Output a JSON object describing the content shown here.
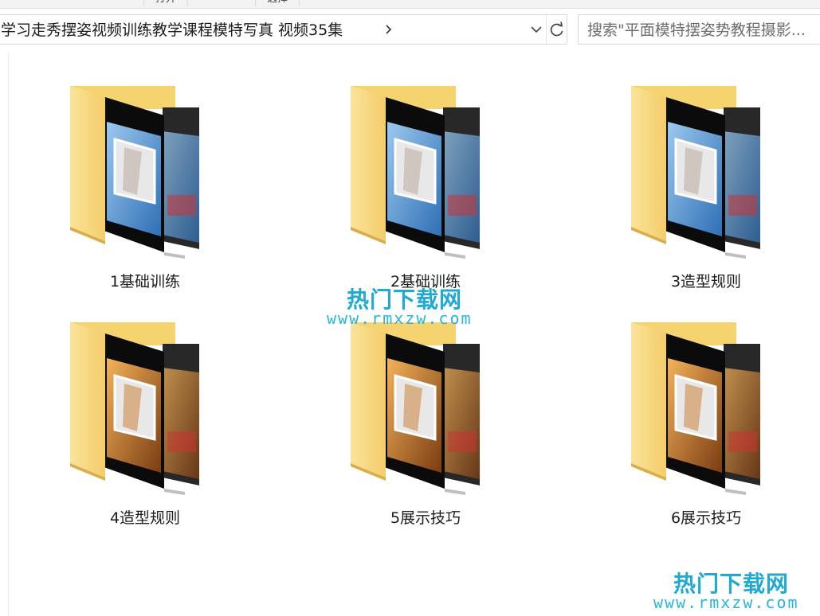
{
  "toolbar": {
    "tab_partial_1": "打开",
    "tab_partial_2": "选择"
  },
  "address": {
    "path": "学习走秀摆姿视频训练教学课程模特写真 视频35集",
    "chevron": "›",
    "dropdown": "⌄",
    "refresh": "↻"
  },
  "search": {
    "placeholder": "搜索\"平面模特摆姿势教程摄影..."
  },
  "folders": [
    {
      "name": "1基础训练",
      "theme": "legs-blue",
      "accent": "#7ab8e8"
    },
    {
      "name": "2基础训练",
      "theme": "legs-white",
      "accent": "#5a9fe0"
    },
    {
      "name": "3造型规则",
      "theme": "legs-gray",
      "accent": "#4f86c9"
    },
    {
      "name": "4造型规则",
      "theme": "presenter-orange",
      "accent": "#e39a3c"
    },
    {
      "name": "5展示技巧",
      "theme": "photo-orange",
      "accent": "#d9832e"
    },
    {
      "name": "6展示技巧",
      "theme": "photo-orange-dark",
      "accent": "#c8702a"
    }
  ],
  "watermarks": [
    {
      "title": "热门下载网",
      "url": "www.rmxzw.com"
    },
    {
      "title": "热门下载网",
      "url": "www.rmxzw.com"
    }
  ],
  "colors": {
    "folder_yellow": "#f8d77a",
    "folder_yellow_dark": "#e8bd55",
    "watermark_blue": "#1fa9d4"
  }
}
